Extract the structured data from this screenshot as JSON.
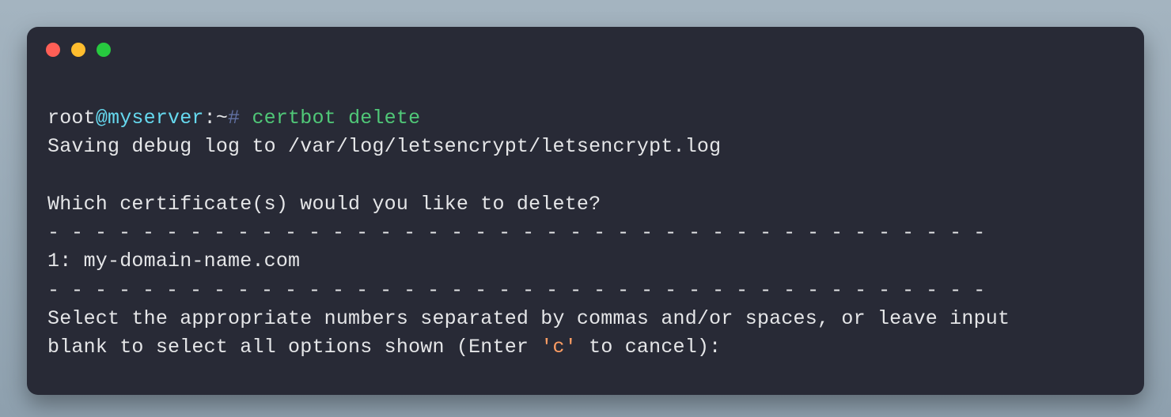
{
  "prompt": {
    "user": "root",
    "at": "@",
    "host": "myserver",
    "colon": ":",
    "path": "~",
    "hash": "# ",
    "command": "certbot delete"
  },
  "output": {
    "line_log": "Saving debug log to /var/log/letsencrypt/letsencrypt.log",
    "blank": "",
    "question": "Which certificate(s) would you like to delete?",
    "divider1": "- - - - - - - - - - - - - - - - - - - - - - - - - - - - - - - - - - - - - - - -",
    "cert_option": "1: my-domain-name.com",
    "divider2": "- - - - - - - - - - - - - - - - - - - - - - - - - - - - - - - - - - - - - - - -",
    "instr_pre": "Select the appropriate numbers separated by commas and/or spaces, or leave input\nblank to select all options shown (Enter ",
    "instr_c": "'c'",
    "instr_post": " to cancel):"
  }
}
